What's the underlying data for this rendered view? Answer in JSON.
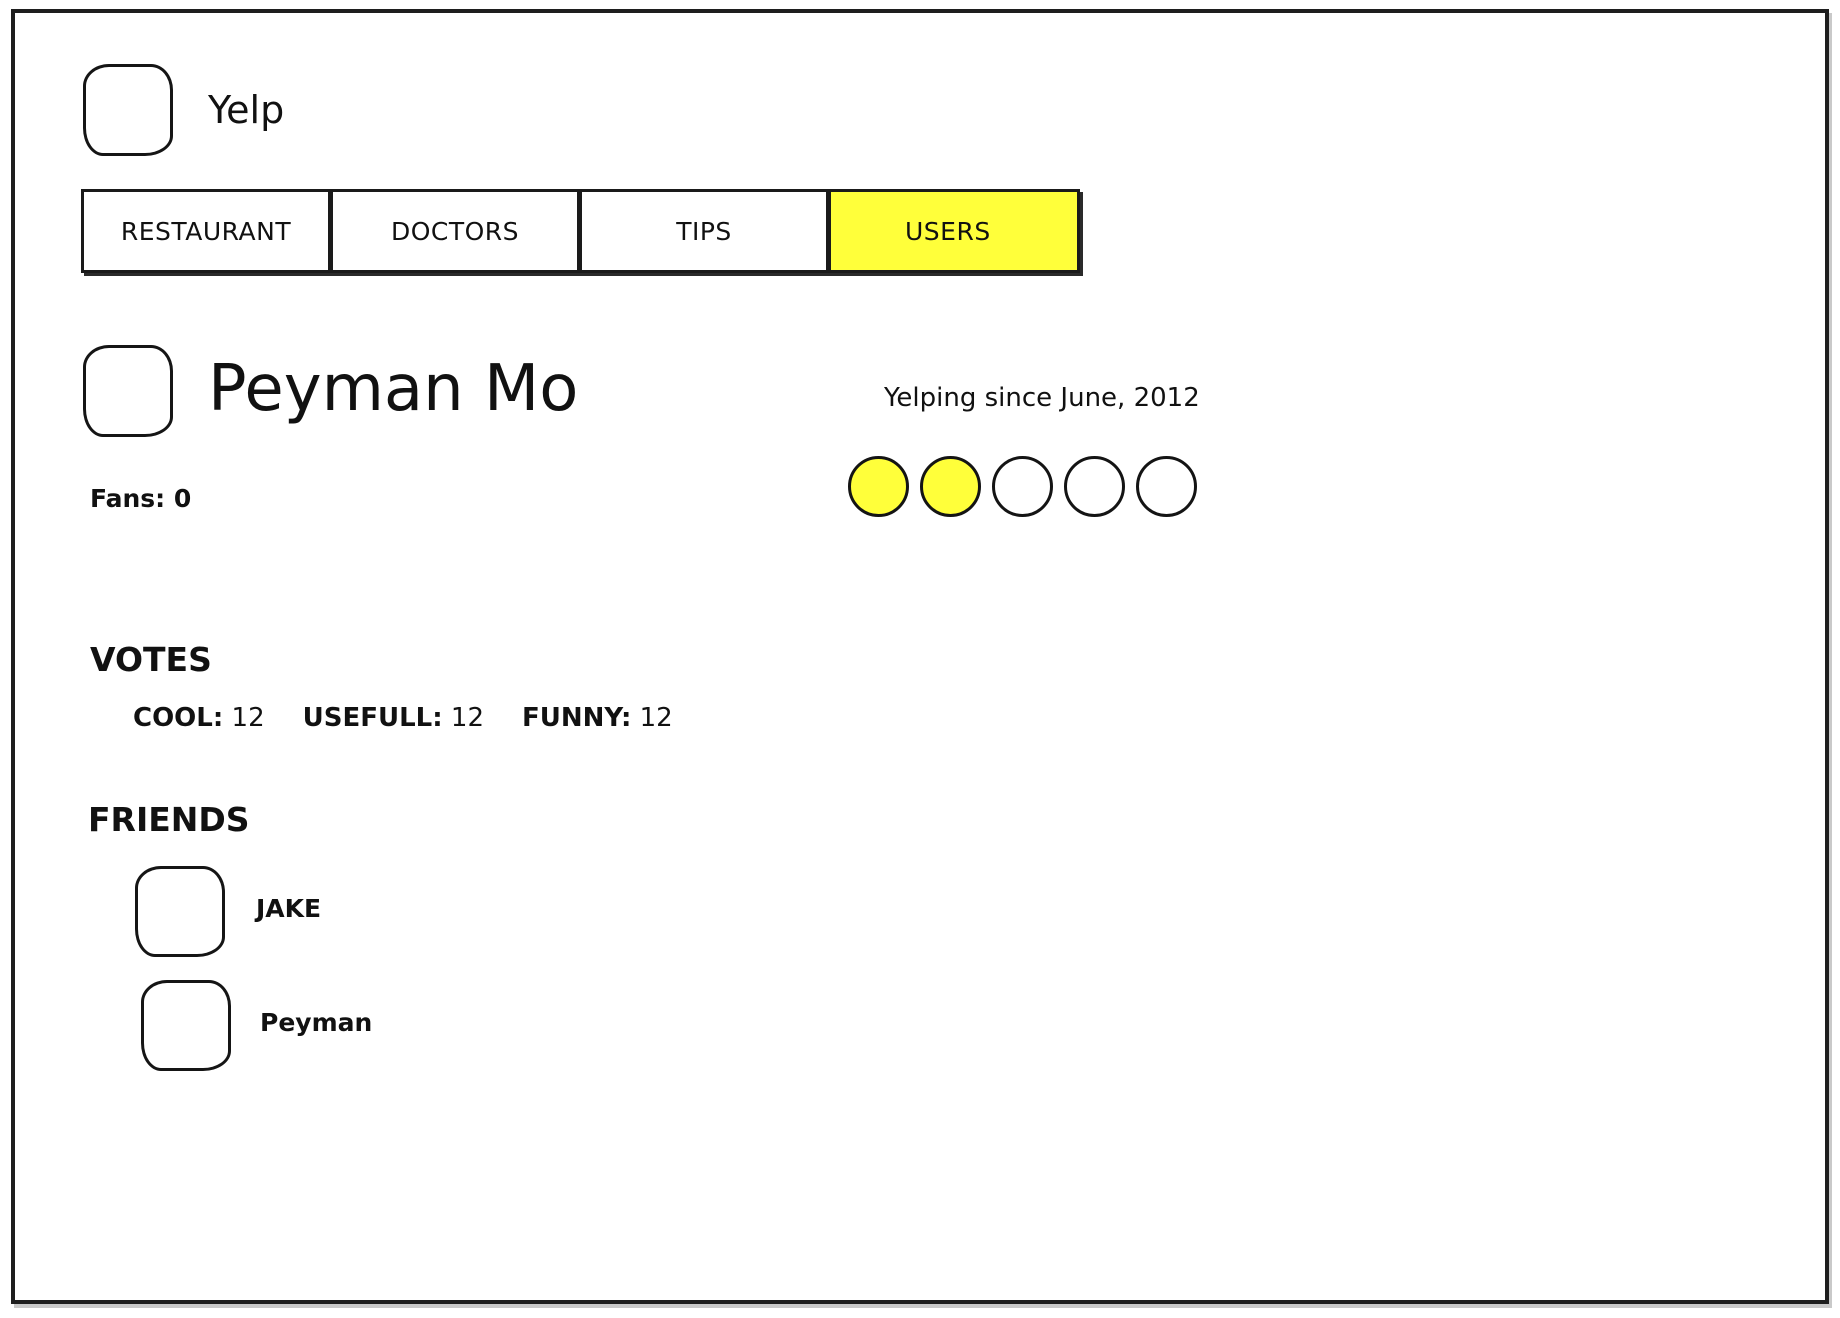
{
  "app": {
    "name": "Yelp"
  },
  "tabs": [
    {
      "label": "RESTAURANT",
      "active": false
    },
    {
      "label": "DOCTORS",
      "active": false
    },
    {
      "label": "TIPS",
      "active": false
    },
    {
      "label": "USERS",
      "active": true
    }
  ],
  "profile": {
    "name": "Peyman Mo",
    "since": "Yelping since June, 2012",
    "fans": "Fans: 0",
    "rating": {
      "value": 2,
      "max": 5
    }
  },
  "votes": {
    "title": "VOTES",
    "items": [
      {
        "label": "COOL:",
        "value": "12"
      },
      {
        "label": "USEFULL:",
        "value": "12"
      },
      {
        "label": "FUNNY:",
        "value": "12"
      }
    ]
  },
  "friends": {
    "title": "FRIENDS",
    "items": [
      {
        "name": "JAKE"
      },
      {
        "name": "Peyman"
      }
    ]
  },
  "colors": {
    "accent": "#ffff3a",
    "ink": "#151515"
  }
}
